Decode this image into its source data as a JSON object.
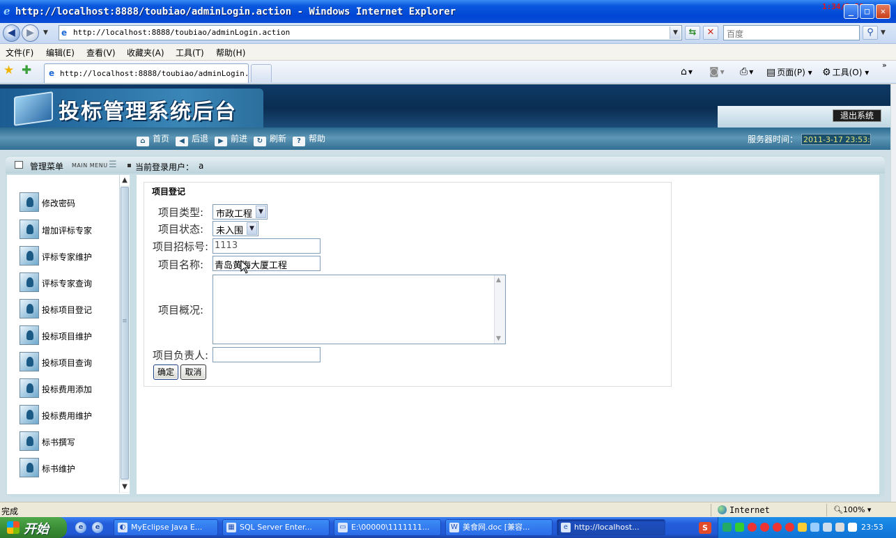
{
  "window": {
    "title": "http://localhost:8888/toubiao/adminLogin.action - Windows Internet Explorer",
    "corner_text": "1:34/2:58"
  },
  "address_bar": {
    "url": "http://localhost:8888/toubiao/adminLogin.action",
    "search_placeholder": "百度"
  },
  "menubar": [
    "文件(F)",
    "编辑(E)",
    "查看(V)",
    "收藏夹(A)",
    "工具(T)",
    "帮助(H)"
  ],
  "tab": {
    "label": "http://localhost:8888/toubiao/adminLogin...."
  },
  "command_bar": {
    "page": "页面(P)",
    "tools": "工具(O)"
  },
  "app": {
    "system_title": "投标管理系统后台",
    "logout": "退出系统",
    "nav": [
      "首页",
      "后退",
      "前进",
      "刷新",
      "帮助"
    ],
    "server_time_label": "服务器时间：",
    "server_time": "2011-3-17 23:53:",
    "menu_title": "管理菜单",
    "menu_title_en": "MAIN MENU",
    "current_user_label": "当前登录用户：",
    "current_user": "a",
    "sidebar_items": [
      "修改密码",
      "增加评标专家",
      "评标专家维护",
      "评标专家查询",
      "投标项目登记",
      "投标项目维护",
      "投标项目查询",
      "投标费用添加",
      "投标费用维护",
      "标书撰写",
      "标书维护"
    ]
  },
  "form": {
    "legend": "项目登记",
    "type_label": "项目类型:",
    "type_value": "市政工程",
    "status_label": "项目状态:",
    "status_value": "未入围",
    "bid_no_label": "项目招标号:",
    "bid_no_value": "1113",
    "name_label": "项目名称:",
    "name_value": "青岛黄海大厦工程",
    "overview_label": "项目概况:",
    "overview_value": "",
    "owner_label": "项目负责人:",
    "owner_value": "",
    "ok": "确定",
    "cancel": "取消"
  },
  "statusbar": {
    "status": "完成",
    "zone": "Internet",
    "zoom": "100%"
  },
  "taskbar": {
    "start": "开始",
    "tasks": [
      "MyEclipse Java E...",
      "SQL Server Enter...",
      "E:\\00000\\1111111...",
      "美食网.doc [兼容...",
      "http://localhost..."
    ],
    "clock": "23:53"
  }
}
